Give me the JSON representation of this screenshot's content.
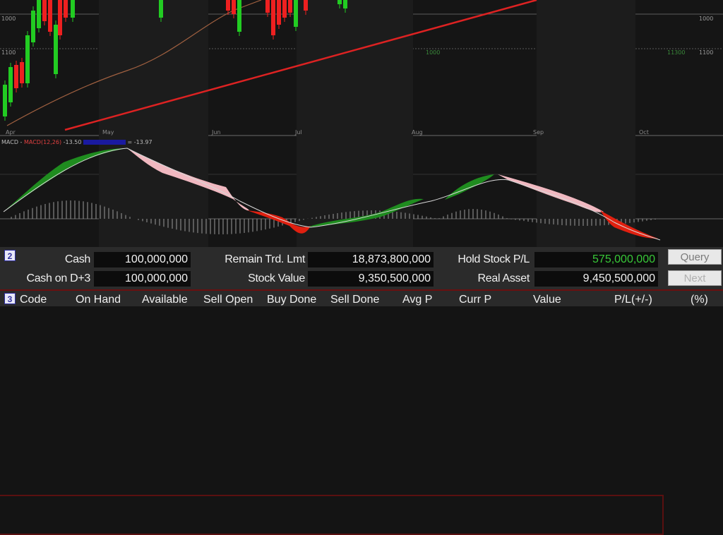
{
  "chart": {
    "month_labels": [
      "Apr",
      "May",
      "Jun",
      "Jul",
      "Aug",
      "Sep",
      "Oct"
    ],
    "price_labels": {
      "left_upper": "1000",
      "left_lower": "1100",
      "right_upper": "1000",
      "right_lower": "1100",
      "mid_lower": "1000",
      "right_lower_2": "11300"
    },
    "macd_legend": {
      "prefix": "MACD -",
      "red": "MACD(12,26)",
      "value1": "-13.50",
      "value2": "= -13.97"
    },
    "colors": {
      "up": "#22cc22",
      "down": "#ee2020",
      "trend": "#dd2222",
      "ma": "#a06040"
    }
  },
  "panel": {
    "row1": {
      "badge": "2",
      "cash_label": "Cash",
      "cash_value": "100,000,000",
      "remain_label": "Remain Trd. Lmt",
      "remain_value": "18,873,800,000",
      "hold_label": "Hold Stock P/L",
      "hold_value": "575,000,000"
    },
    "row2": {
      "cash_d3_label": "Cash on D+3",
      "cash_d3_value": "100,000,000",
      "stock_label": "Stock Value",
      "stock_value": "9,350,500,000",
      "real_label": "Real Asset",
      "real_value": "9,450,500,000"
    },
    "buttons": {
      "query": "Query",
      "next": "Next"
    },
    "colors": {
      "positive": "#38c838"
    }
  },
  "table_header": {
    "badge": "3",
    "columns": [
      "Code",
      "On Hand",
      "Available",
      "Sell Open",
      "Buy Done",
      "Sell Done",
      "Avg P",
      "Curr P",
      "Value",
      "P/L(+/-)",
      "(%)"
    ]
  }
}
